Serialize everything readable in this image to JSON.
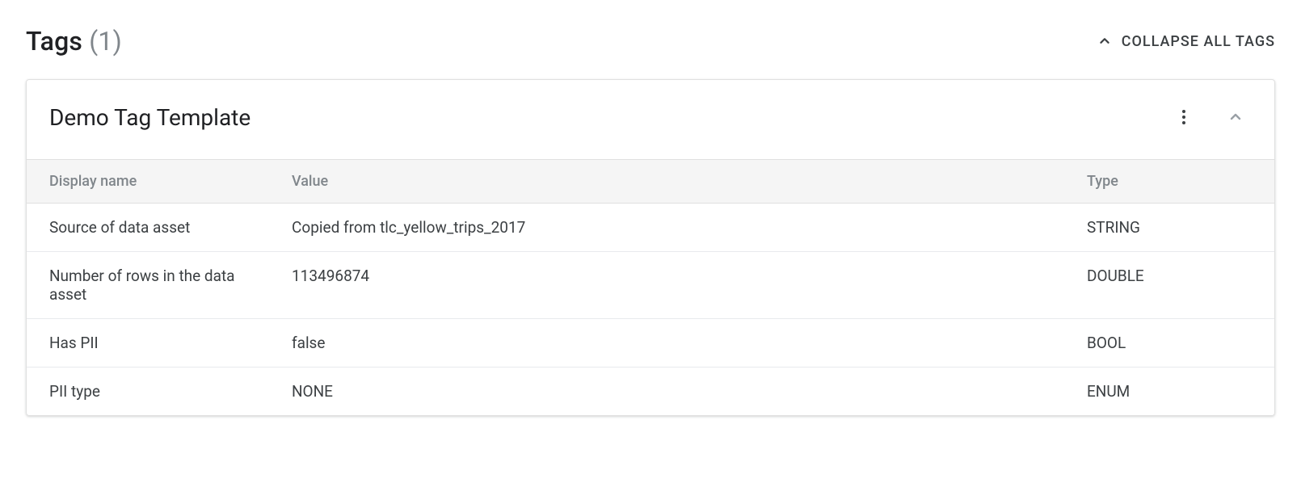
{
  "section": {
    "title": "Tags",
    "count": "(1)",
    "collapse_label": "COLLAPSE ALL TAGS"
  },
  "card": {
    "title": "Demo Tag Template",
    "columns": {
      "display_name": "Display name",
      "value": "Value",
      "type": "Type"
    },
    "rows": [
      {
        "display_name": "Source of data asset",
        "value": "Copied from tlc_yellow_trips_2017",
        "type": "STRING"
      },
      {
        "display_name": "Number of rows in the data asset",
        "value": "113496874",
        "type": "DOUBLE"
      },
      {
        "display_name": "Has PII",
        "value": "false",
        "type": "BOOL"
      },
      {
        "display_name": "PII type",
        "value": "NONE",
        "type": "ENUM"
      }
    ]
  }
}
